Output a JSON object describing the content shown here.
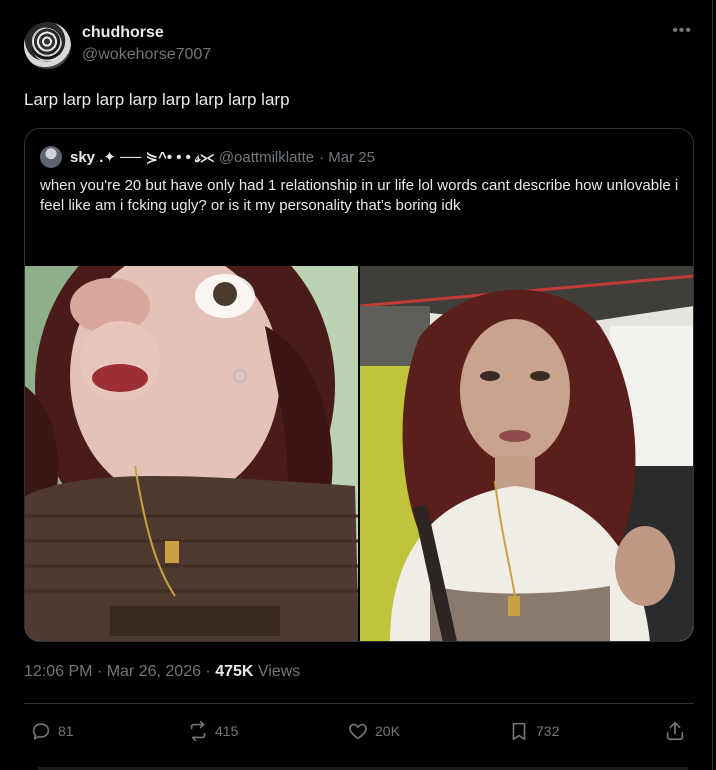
{
  "author": {
    "display_name": "chudhorse",
    "handle": "@wokehorse7007"
  },
  "tweet": {
    "text": "Larp larp larp larp larp larp larp larp"
  },
  "quote": {
    "display_name": "sky .✦ ── ⋟^• • • 𝓈⪥",
    "handle": "@oattmilklatte",
    "date": "· Mar 25",
    "text": "when you're 20 but have only had 1 relationship in ur life lol words cant describe how unlovable i feel like am i fcking ugly? or is it my personality that's boring idk"
  },
  "meta": {
    "time": "12:06 PM · Mar 26, 2026 · ",
    "views_count": "475K",
    "views_label": " Views"
  },
  "actions": {
    "replies": "81",
    "reposts": "415",
    "likes": "20K",
    "bookmarks": "732"
  },
  "icons": {
    "more": "more-icon",
    "reply": "reply-icon",
    "repost": "repost-icon",
    "like": "heart-icon",
    "bookmark": "bookmark-icon",
    "share": "share-icon"
  },
  "colors": {
    "background": "#000000",
    "text": "#e7e9ea",
    "secondary": "#71767b",
    "border": "#2f3336"
  }
}
